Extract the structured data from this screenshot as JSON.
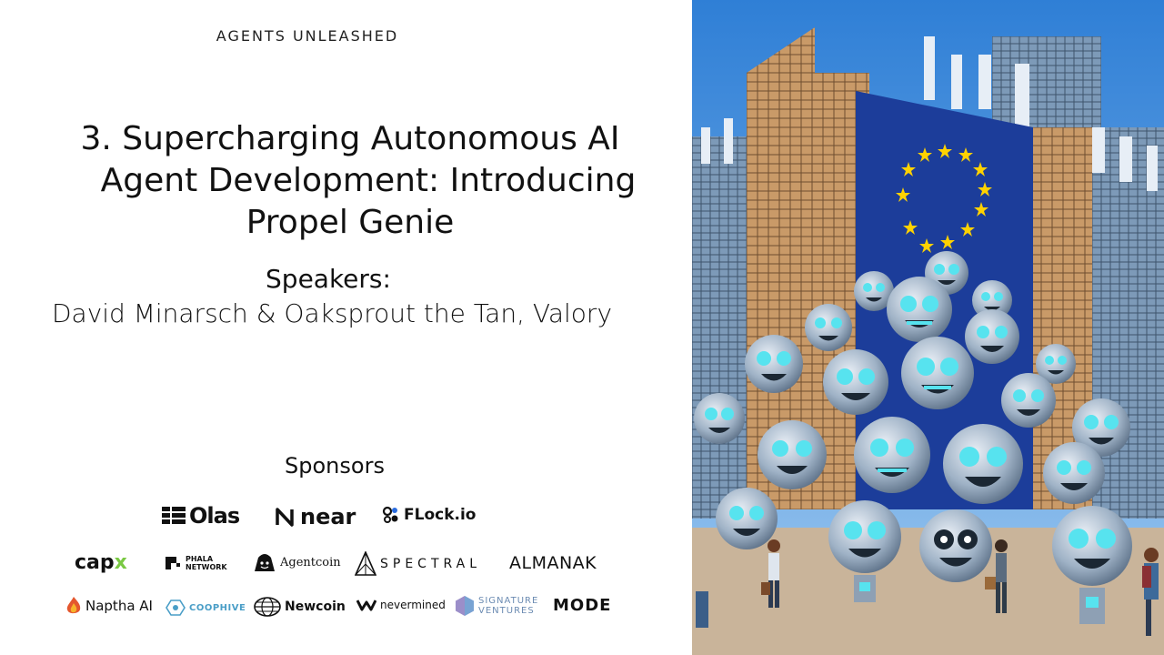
{
  "brand": "AGENTS UNLEASHED",
  "title": {
    "line1": "3. Supercharging Autonomous AI",
    "line2": "Agent Development: Introducing",
    "line3": "Propel Genie"
  },
  "speakers": {
    "heading": "Speakers:",
    "names": "David Minarsch & Oaksprout the Tan, Valory"
  },
  "sponsors": {
    "heading": "Sponsors",
    "row1": [
      "Olas",
      "near",
      "FLock.io"
    ],
    "row2": [
      "capx",
      "PHALA NETWORK",
      "Agentcoin",
      "SPECTRAL",
      "ALMANAK"
    ],
    "row3": [
      "Naptha AI",
      "COOPHIVE",
      "Newcoin",
      "nevermined",
      "SIGNATURE VENTURES",
      "MODE"
    ]
  },
  "colors": {
    "eu_blue": "#1c3d9a",
    "eu_star": "#ffd200",
    "sky": "#5aa0e6",
    "robot_eye": "#57e3ef",
    "building_brown": "#b88456"
  }
}
